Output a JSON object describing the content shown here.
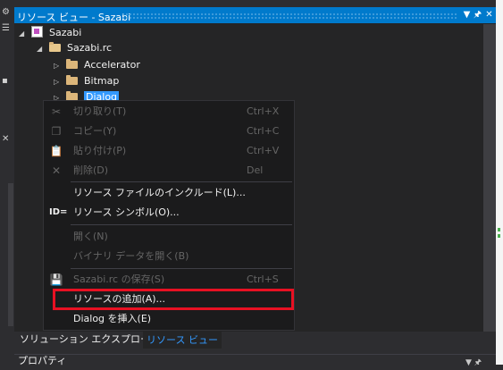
{
  "window": {
    "title": "リソース ビュー - Sazabi",
    "buttons": {
      "dropdown": "▼",
      "pin": "🖈",
      "close": "✕"
    }
  },
  "tree": {
    "root": "Sazabi",
    "rc": "Sazabi.rc",
    "folders": [
      "Accelerator",
      "Bitmap",
      "Dialog"
    ]
  },
  "context_menu": {
    "items": [
      {
        "label": "切り取り(T)",
        "shortcut": "Ctrl+X",
        "icon": "scissors-icon",
        "glyph": "✂",
        "enabled": false
      },
      {
        "label": "コピー(Y)",
        "shortcut": "Ctrl+C",
        "icon": "copy-icon",
        "glyph": "❐",
        "enabled": false
      },
      {
        "label": "貼り付け(P)",
        "shortcut": "Ctrl+V",
        "icon": "paste-icon",
        "glyph": "📋",
        "enabled": false
      },
      {
        "label": "削除(D)",
        "shortcut": "Del",
        "icon": "delete-x-icon",
        "glyph": "✕",
        "enabled": false
      },
      {
        "label": "リソース ファイルのインクルード(L)...",
        "shortcut": "",
        "icon": "",
        "glyph": "",
        "enabled": true
      },
      {
        "label": "リソース シンボル(O)...",
        "shortcut": "",
        "icon": "id-icon",
        "glyph": "ID=",
        "enabled": true
      },
      {
        "label": "開く(N)",
        "shortcut": "",
        "icon": "",
        "glyph": "",
        "enabled": false
      },
      {
        "label": "バイナリ データを開く(B)",
        "shortcut": "",
        "icon": "",
        "glyph": "",
        "enabled": false
      },
      {
        "label": "Sazabi.rc の保存(S)",
        "shortcut": "Ctrl+S",
        "icon": "save-icon",
        "glyph": "💾",
        "enabled": false
      },
      {
        "label": "リソースの追加(A)...",
        "shortcut": "",
        "icon": "",
        "glyph": "",
        "enabled": true
      },
      {
        "label": "Dialog を挿入(E)",
        "shortcut": "",
        "icon": "",
        "glyph": "",
        "enabled": true
      }
    ]
  },
  "tabs": {
    "solution_explorer": "ソリューション エクスプローラー",
    "resource_view": "リソース ビュー"
  },
  "properties": {
    "title": "プロパティ",
    "pin": "▼ 🖈"
  },
  "colors": {
    "accent": "#007acc",
    "selection": "#3399ff",
    "highlight_box": "#e81123",
    "background": "#252526",
    "menu_background": "#1b1b1c"
  }
}
